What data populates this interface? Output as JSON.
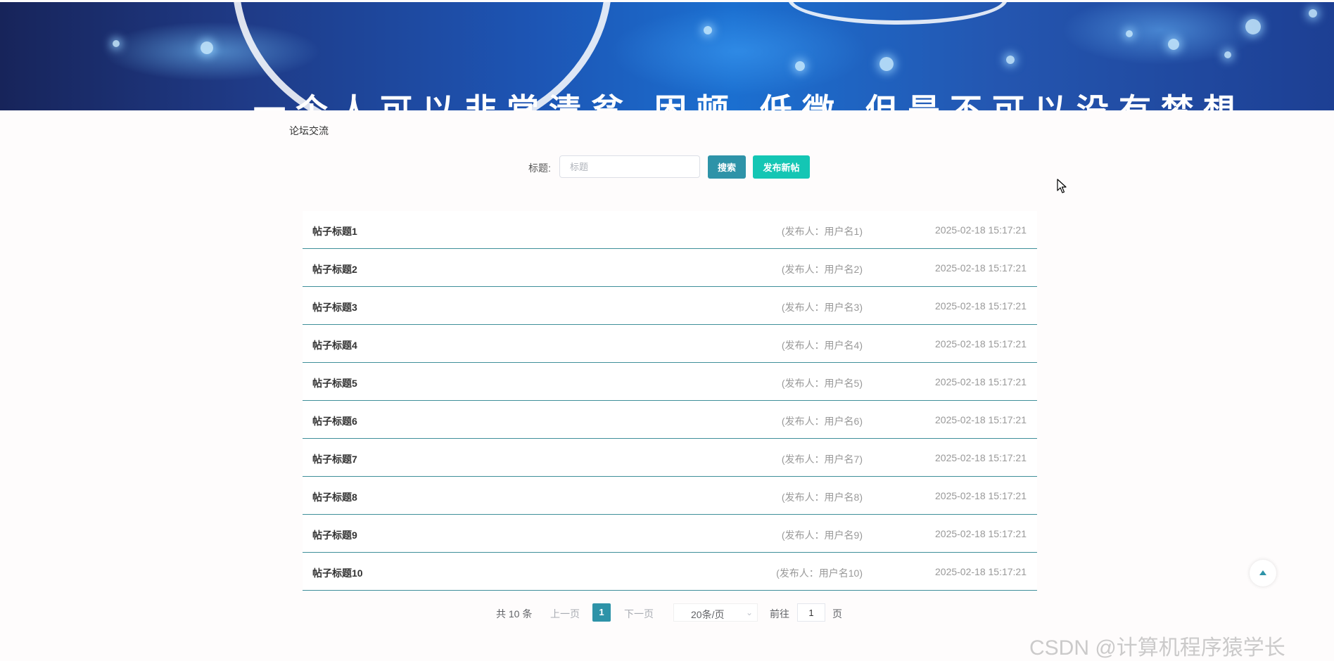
{
  "banner": {
    "slogan": "一个人可以非常清贫  困顿  低微  但是不可以没有梦想"
  },
  "breadcrumb": "论坛交流",
  "search": {
    "label": "标题:",
    "placeholder": "标题",
    "value": "",
    "search_button": "搜索",
    "new_post_button": "发布新帖"
  },
  "posts": [
    {
      "title": "帖子标题1",
      "author": "(发布人：用户名1)",
      "time": "2025-02-18 15:17:21"
    },
    {
      "title": "帖子标题2",
      "author": "(发布人：用户名2)",
      "time": "2025-02-18 15:17:21"
    },
    {
      "title": "帖子标题3",
      "author": "(发布人：用户名3)",
      "time": "2025-02-18 15:17:21"
    },
    {
      "title": "帖子标题4",
      "author": "(发布人：用户名4)",
      "time": "2025-02-18 15:17:21"
    },
    {
      "title": "帖子标题5",
      "author": "(发布人：用户名5)",
      "time": "2025-02-18 15:17:21"
    },
    {
      "title": "帖子标题6",
      "author": "(发布人：用户名6)",
      "time": "2025-02-18 15:17:21"
    },
    {
      "title": "帖子标题7",
      "author": "(发布人：用户名7)",
      "time": "2025-02-18 15:17:21"
    },
    {
      "title": "帖子标题8",
      "author": "(发布人：用户名8)",
      "time": "2025-02-18 15:17:21"
    },
    {
      "title": "帖子标题9",
      "author": "(发布人：用户名9)",
      "time": "2025-02-18 15:17:21"
    },
    {
      "title": "帖子标题10",
      "author": "(发布人：用户名10)",
      "time": "2025-02-18 15:17:21"
    }
  ],
  "pagination": {
    "total": "共 10 条",
    "prev": "上一页",
    "current_page": "1",
    "next": "下一页",
    "page_size": "20条/页",
    "goto_label": "前往",
    "goto_value": "1",
    "goto_suffix": "页"
  },
  "icons": {
    "back_to_top": "arrow-up-icon",
    "page_size_dropdown": "chevron-down-icon",
    "cursor": "mouse-pointer-icon"
  },
  "colors": {
    "primary": "#2e93a8",
    "new_post": "#14c6b4",
    "row_divider": "#3f8f9a"
  },
  "watermark": "CSDN @计算机程序猿学长"
}
